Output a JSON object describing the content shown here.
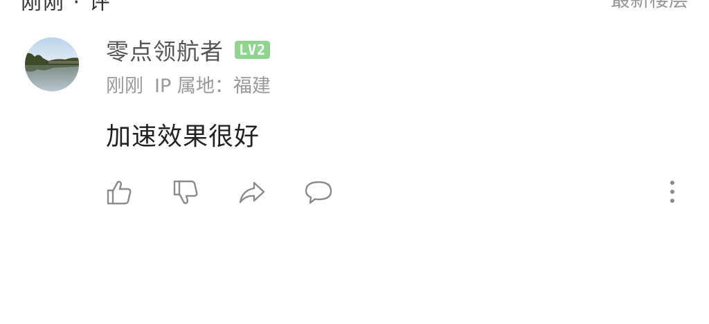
{
  "header": {
    "left_fragment": "刚刚 · 评",
    "right_fragment": "最新楼层"
  },
  "comment": {
    "username": "零点领航者",
    "level_badge": "LV2",
    "time": "刚刚",
    "ip_location": "IP 属地：福建",
    "text": "加速效果很好"
  },
  "actions": {
    "icons": [
      "thumbs-up-icon",
      "thumbs-down-icon",
      "share-icon",
      "comment-icon",
      "more-icon"
    ]
  },
  "colors": {
    "badge": "#8fd48f",
    "meta_text": "#999999",
    "icon_stroke": "#8a8a8a"
  }
}
